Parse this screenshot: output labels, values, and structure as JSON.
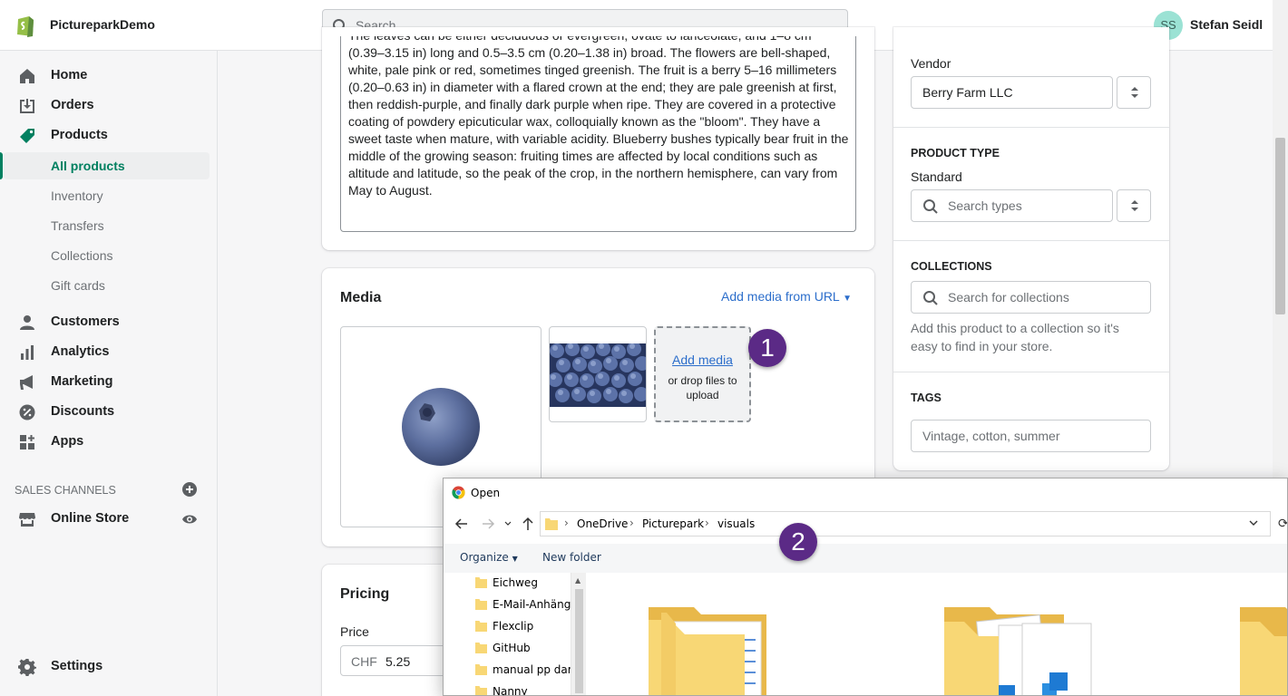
{
  "topbar": {
    "store_name": "PictureparkDemo",
    "search_placeholder": "Search",
    "user_initials": "SS",
    "user_name": "Stefan Seidl"
  },
  "sidebar": {
    "items": [
      {
        "label": "Home",
        "icon": "home-icon"
      },
      {
        "label": "Orders",
        "icon": "orders-icon"
      },
      {
        "label": "Products",
        "icon": "tag-icon"
      }
    ],
    "sub_items": [
      "All products",
      "Inventory",
      "Transfers",
      "Collections",
      "Gift cards"
    ],
    "items2": [
      {
        "label": "Customers",
        "icon": "person-icon"
      },
      {
        "label": "Analytics",
        "icon": "bar-chart-icon"
      },
      {
        "label": "Marketing",
        "icon": "megaphone-icon"
      },
      {
        "label": "Discounts",
        "icon": "discount-icon"
      },
      {
        "label": "Apps",
        "icon": "apps-icon"
      }
    ],
    "channels_heading": "SALES CHANNELS",
    "online_store": "Online Store",
    "settings": "Settings"
  },
  "description": {
    "text": "The leaves can be either deciduous or evergreen, ovate to lanceolate, and 1–8 cm (0.39–3.15 in) long and 0.5–3.5 cm (0.20–1.38 in) broad. The flowers are bell-shaped, white, pale pink or red, sometimes tinged greenish. The fruit is a berry 5–16 millimeters (0.20–0.63 in) in diameter with a flared crown at the end; they are pale greenish at first, then reddish-purple, and finally dark purple when ripe. They are covered in a protective coating of powdery epicuticular wax, colloquially known as the \"bloom\". They have a sweet taste when mature, with variable acidity. Blueberry bushes typically bear fruit in the middle of the growing season: fruiting times are affected by local conditions such as altitude and latitude, so the peak of the crop, in the northern hemisphere, can vary from May to August."
  },
  "media": {
    "title": "Media",
    "add_from_url": "Add media from URL",
    "add_media": "Add media",
    "drop_hint": "or drop files to upload"
  },
  "pricing": {
    "title": "Pricing",
    "price_label": "Price",
    "currency": "CHF",
    "price_value": "5.25"
  },
  "organization": {
    "vendor_label": "Vendor",
    "vendor_value": "Berry Farm LLC",
    "product_type_heading": "PRODUCT TYPE",
    "product_type_value": "Standard",
    "product_type_placeholder": "Search types",
    "collections_heading": "COLLECTIONS",
    "collections_placeholder": "Search for collections",
    "collections_help": "Add this product to a collection so it's easy to find in your store.",
    "tags_heading": "TAGS",
    "tags_placeholder": "Vintage, cotton, summer"
  },
  "annotations": [
    "1",
    "2"
  ],
  "dialog": {
    "title": "Open",
    "path": [
      "OneDrive",
      "Picturepark",
      "visuals"
    ],
    "organize": "Organize",
    "new_folder": "New folder",
    "folders": [
      "Eichweg",
      "E-Mail-Anhänge",
      "Flexclip",
      "GitHub",
      "manual pp dam",
      "Nanny"
    ]
  },
  "colors": {
    "accent_green": "#008060",
    "link_blue": "#2c6ecb",
    "badge_purple": "#5b2a86",
    "folder_yellow": "#f8d775"
  }
}
